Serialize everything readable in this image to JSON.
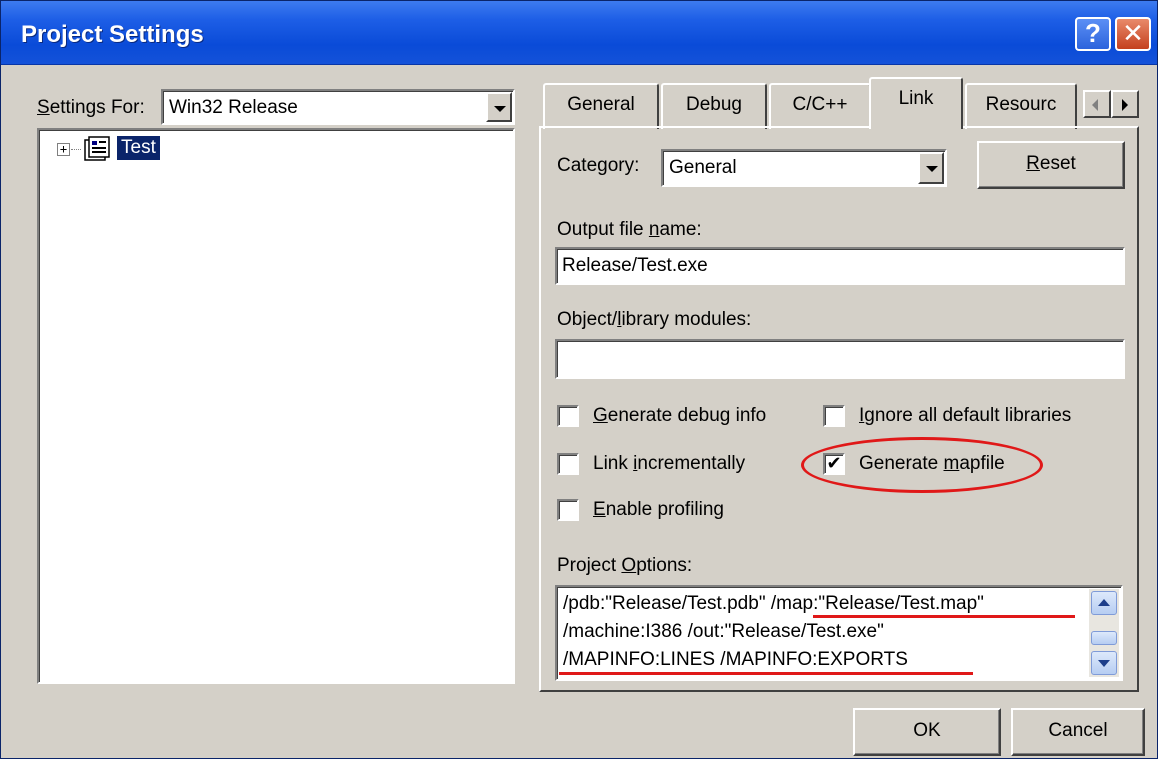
{
  "window": {
    "title": "Project Settings",
    "help_glyph": "?",
    "close_glyph": "✕"
  },
  "settings_for": {
    "label_prefix": "S",
    "label_rest": "ettings For:",
    "value": "Win32 Release"
  },
  "tree": {
    "expander": "+",
    "item_label": "Test"
  },
  "tabs": [
    {
      "label": "General",
      "active": false
    },
    {
      "label": "Debug",
      "active": false
    },
    {
      "label": "C/C++",
      "active": false
    },
    {
      "label": "Link",
      "active": true
    },
    {
      "label": "Resourc",
      "active": false
    }
  ],
  "link_tab": {
    "category": {
      "label_pre": "Category:",
      "value": "General"
    },
    "reset": {
      "ul": "R",
      "rest": "eset"
    },
    "output_file": {
      "label_pre": "Output file ",
      "label_ul": "n",
      "label_post": "ame:",
      "value": "Release/Test.exe"
    },
    "object_modules": {
      "label_pre": "Object/",
      "label_ul": "l",
      "label_post": "ibrary modules:",
      "value": ""
    },
    "checkboxes": [
      {
        "id": "debug-info",
        "pre": "",
        "ul": "G",
        "post": "enerate debug info",
        "checked": false
      },
      {
        "id": "ignore-libs",
        "pre": "",
        "ul": "I",
        "post": "gnore all default libraries",
        "checked": false
      },
      {
        "id": "link-incr",
        "pre": "Link ",
        "ul": "i",
        "post": "ncrementally",
        "checked": false
      },
      {
        "id": "gen-mapfile",
        "pre": "Generate ",
        "ul": "m",
        "post": "apfile",
        "checked": true
      },
      {
        "id": "profiling",
        "pre": "",
        "ul": "E",
        "post": "nable profiling",
        "checked": false
      }
    ],
    "checkmark": "✔",
    "project_options": {
      "label_pre": "Project ",
      "label_ul": "O",
      "label_post": "ptions:",
      "lines": [
        "/pdb:\"Release/Test.pdb\" /map:\"Release/Test.map\"",
        "/machine:I386 /out:\"Release/Test.exe\"",
        "/MAPINFO:LINES /MAPINFO:EXPORTS"
      ]
    }
  },
  "footer": {
    "ok": "OK",
    "cancel": "Cancel"
  },
  "colors": {
    "dialog_bg": "#d4d0c8",
    "title_blue": "#0a4bd8",
    "highlight": "#0a246a",
    "annotation_red": "#e01818"
  }
}
